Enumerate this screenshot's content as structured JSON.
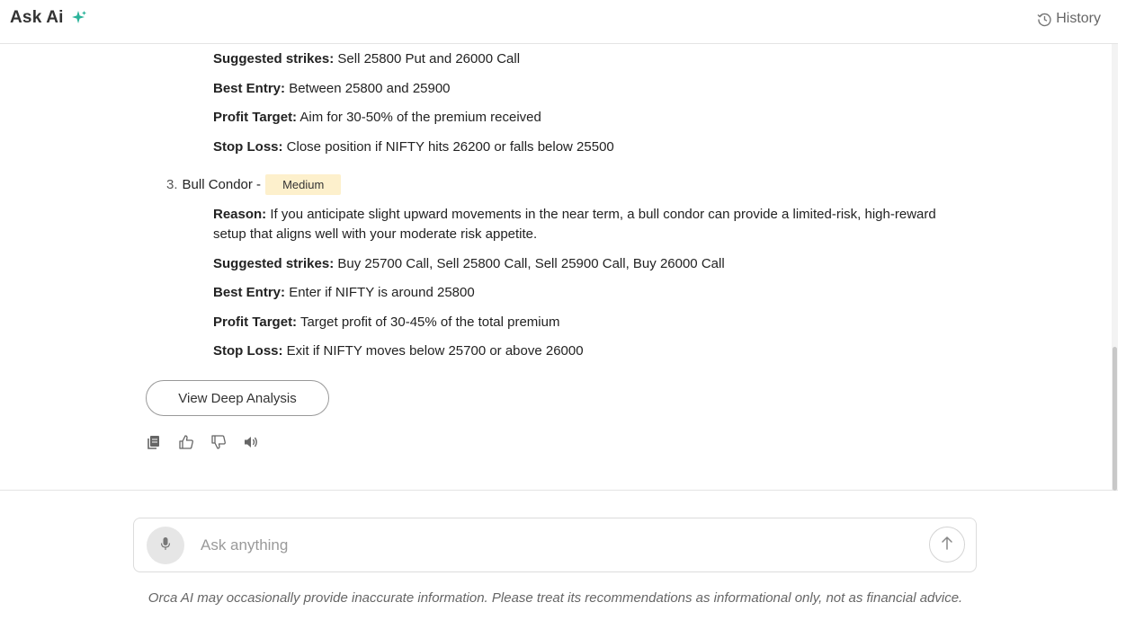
{
  "header": {
    "title": "Ask Ai",
    "history_label": "History"
  },
  "previous_strategy": {
    "details": [
      {
        "label": "Suggested strikes:",
        "text": "Sell 25800 Put and 26000 Call"
      },
      {
        "label": "Best Entry:",
        "text": "Between 25800 and 25900"
      },
      {
        "label": "Profit Target:",
        "text": "Aim for 30-50% of the premium received"
      },
      {
        "label": "Stop Loss:",
        "text": "Close position if NIFTY hits 26200 or falls below 25500"
      }
    ]
  },
  "strategy_3": {
    "number": "3.",
    "name": "Bull Condor -",
    "risk_badge": "Medium",
    "details": [
      {
        "label": "Reason:",
        "text": "If you anticipate slight upward movements in the near term, a bull condor can provide a limited-risk, high-reward setup that aligns well with your moderate risk appetite."
      },
      {
        "label": "Suggested strikes:",
        "text": "Buy 25700 Call, Sell 25800 Call, Sell 25900 Call, Buy 26000 Call"
      },
      {
        "label": "Best Entry:",
        "text": "Enter if NIFTY is around 25800"
      },
      {
        "label": "Profit Target:",
        "text": "Target profit of 30-45% of the total premium"
      },
      {
        "label": "Stop Loss:",
        "text": "Exit if NIFTY moves below 25700 or above 26000"
      }
    ]
  },
  "deep_analysis_button": "View Deep Analysis",
  "actions": [
    "copy-icon",
    "thumbs-up-icon",
    "thumbs-down-icon",
    "speaker-icon"
  ],
  "composer": {
    "placeholder": "Ask anything"
  },
  "disclaimer": "Orca AI may occasionally provide inaccurate information. Please treat its recommendations as informational only, not as financial advice.",
  "colors": {
    "accent_sparkle": "#2bb39a",
    "badge_bg": "#fdf0cc"
  }
}
